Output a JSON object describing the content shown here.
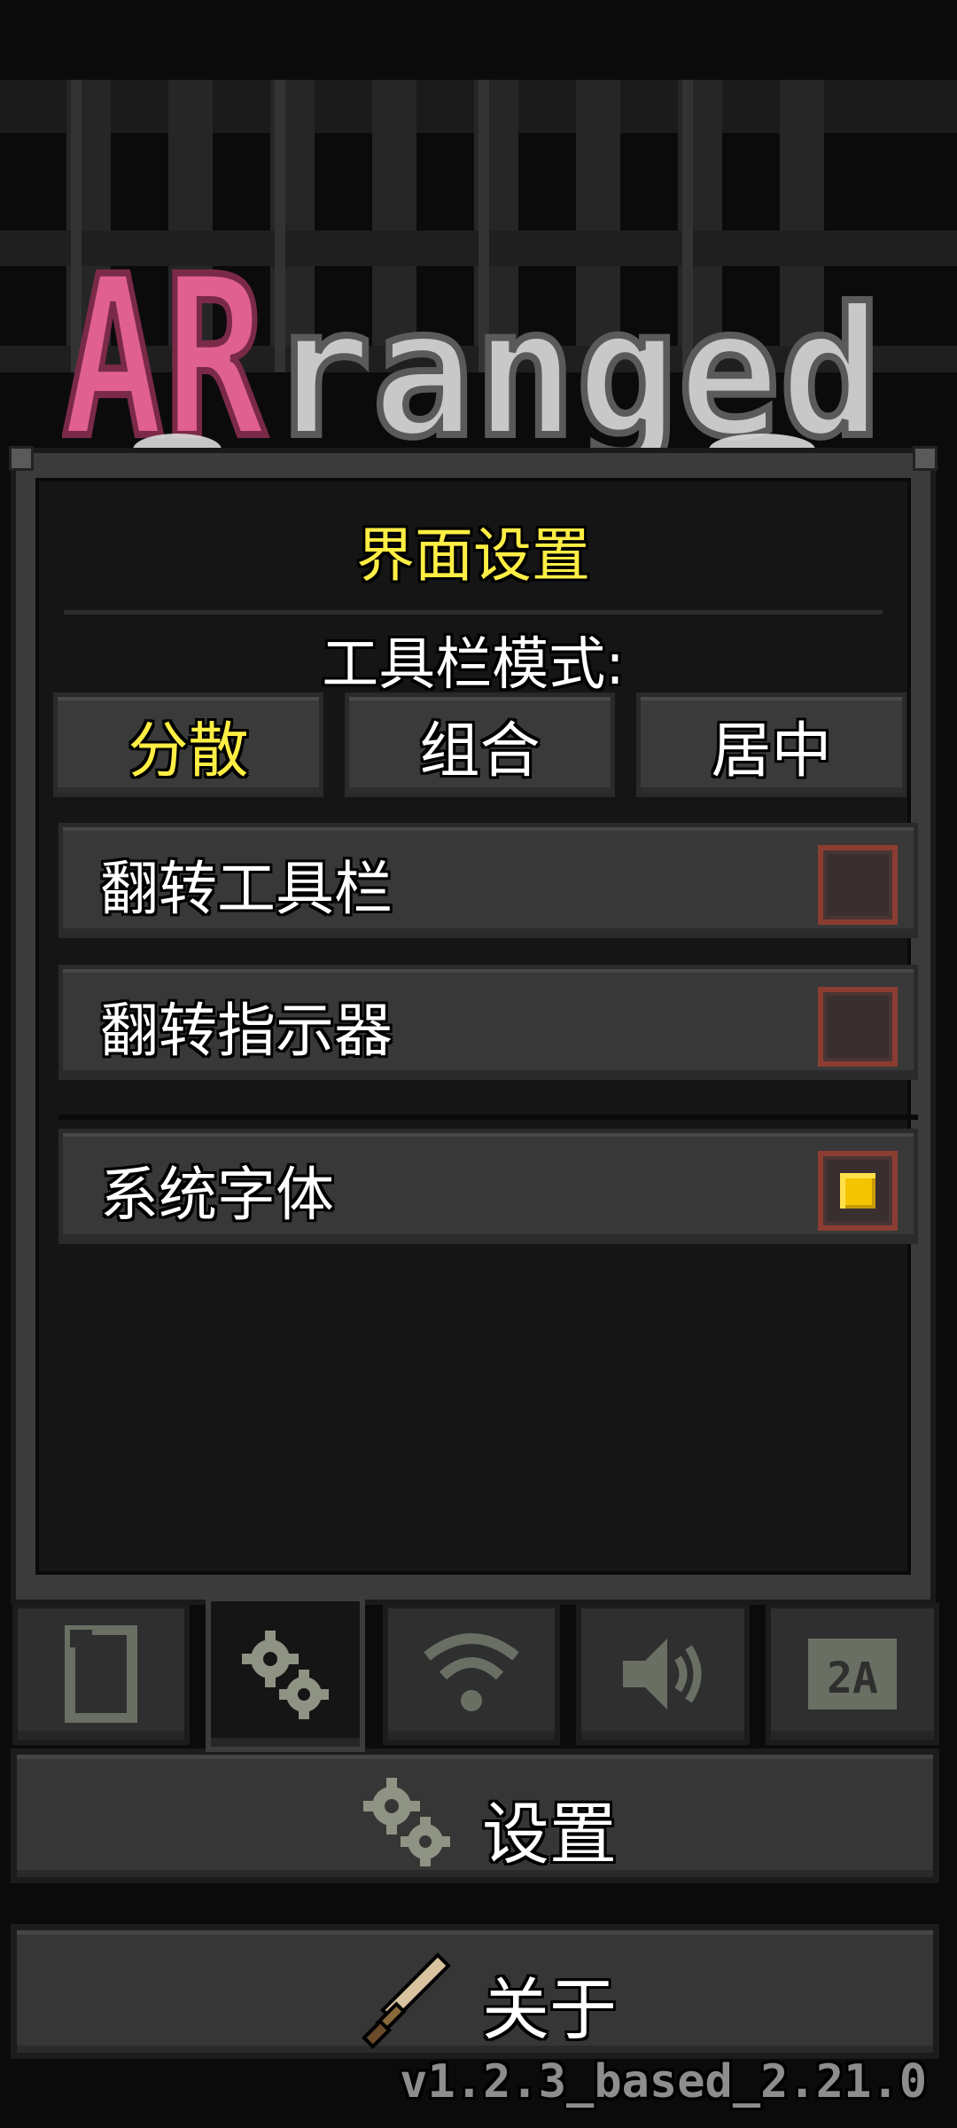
{
  "logo": {
    "text_pink": "AR",
    "text_grey": "ranged"
  },
  "panel": {
    "title": "界面设置",
    "toolbar_mode_label": "工具栏模式:",
    "mode_options": [
      "分散",
      "组合",
      "居中"
    ],
    "selected_mode": "分散",
    "toggles": [
      {
        "label": "翻转工具栏",
        "checked": false
      },
      {
        "label": "翻转指示器",
        "checked": false
      },
      {
        "label": "系统字体",
        "checked": true
      }
    ]
  },
  "tabs": [
    {
      "icon": "display-icon",
      "active": false
    },
    {
      "icon": "gears-icon",
      "active": true
    },
    {
      "icon": "wifi-icon",
      "active": false
    },
    {
      "icon": "speaker-icon",
      "active": false
    },
    {
      "icon": "language-icon",
      "active": false,
      "icon_text": "2A"
    }
  ],
  "buttons": {
    "settings_label": "设置",
    "about_label": "关于"
  },
  "version": "v1.2.3_based_2.21.0",
  "colors": {
    "accent_yellow": "#ffee44",
    "checkbox_border": "#8c3d31",
    "checkbox_fill": "#f5c400",
    "logo_pink": "#e06090",
    "logo_grey": "#c8c8c8"
  }
}
